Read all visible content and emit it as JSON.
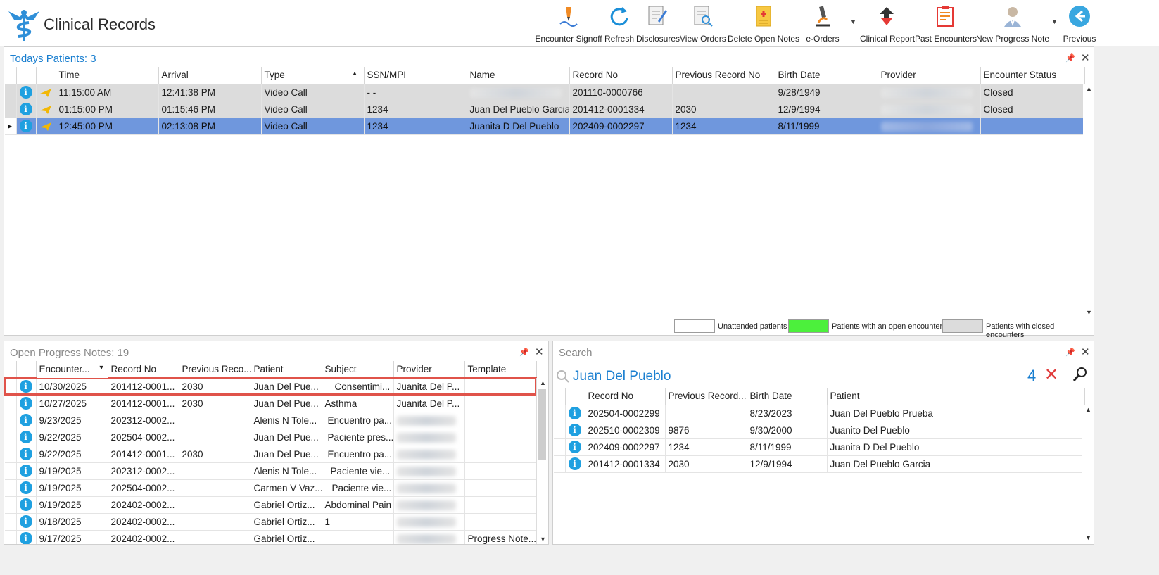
{
  "app": {
    "title": "Clinical Records"
  },
  "toolbar": {
    "encounter_signoff": "Encounter Signoff",
    "refresh": "Refresh",
    "disclosures": "Disclosures",
    "view_orders": "View Orders",
    "delete_open_notes": "Delete Open Notes",
    "e_orders": "e-Orders",
    "clinical_report": "Clinical Report",
    "past_encounters": "Past Encounters",
    "new_progress_note": "New Progress Note",
    "previous": "Previous"
  },
  "todays_patients": {
    "title": "Todays Patients:",
    "count": "3",
    "columns": [
      "Time",
      "Arrival",
      "Type",
      "SSN/MPI",
      "Name",
      "Record No",
      "Previous Record No",
      "Birth Date",
      "Provider",
      "Encounter Status"
    ],
    "rows": [
      {
        "time": "11:15:00 AM",
        "arrival": "12:41:38 PM",
        "type": "Video Call",
        "ssn": "- -",
        "name": "",
        "record_no": "201110-0000766",
        "prev_record": "",
        "birth_date": "9/28/1949",
        "status": "Closed"
      },
      {
        "time": "01:15:00 PM",
        "arrival": "01:15:46 PM",
        "type": "Video Call",
        "ssn": "1234",
        "name": "Juan Del Pueblo Garcia",
        "record_no": "201412-0001334",
        "prev_record": "2030",
        "birth_date": "12/9/1994",
        "status": "Closed"
      },
      {
        "time": "12:45:00 PM",
        "arrival": "02:13:08 PM",
        "type": "Video Call",
        "ssn": "1234",
        "name": "Juanita D Del Pueblo",
        "record_no": "202409-0002297",
        "prev_record": "1234",
        "birth_date": "8/11/1999",
        "status": ""
      }
    ],
    "legend": {
      "unattended": "Unattended patients",
      "open_encounter": "Patients with an open encounter",
      "closed_encounter": "Patients with closed encounters",
      "colors": {
        "unattended": "#ffffff",
        "open": "#4cf03c",
        "closed": "#dcdcdc"
      }
    }
  },
  "open_notes": {
    "title": "Open Progress Notes:",
    "count": "19",
    "columns": [
      "Encounter...",
      "Record No",
      "Previous Reco...",
      "Patient",
      "Subject",
      "Provider",
      "Template"
    ],
    "rows": [
      {
        "date": "10/30/2025",
        "record_no": "201412-0001...",
        "prev": "2030",
        "patient": "Juan Del Pue...",
        "subject": "Consentimi...",
        "provider": "Juanita Del P...",
        "template": ""
      },
      {
        "date": "10/27/2025",
        "record_no": "201412-0001...",
        "prev": "2030",
        "patient": "Juan Del Pue...",
        "subject": "Asthma",
        "provider": "Juanita Del P...",
        "template": ""
      },
      {
        "date": "9/23/2025",
        "record_no": "202312-0002...",
        "prev": "",
        "patient": "Alenis N Tole...",
        "subject": "Encuentro pa...",
        "provider": "",
        "template": ""
      },
      {
        "date": "9/22/2025",
        "record_no": "202504-0002...",
        "prev": "",
        "patient": "Juan Del Pue...",
        "subject": "Paciente pres...",
        "provider": "",
        "template": ""
      },
      {
        "date": "9/22/2025",
        "record_no": "201412-0001...",
        "prev": "2030",
        "patient": "Juan Del Pue...",
        "subject": "Encuentro pa...",
        "provider": "",
        "template": ""
      },
      {
        "date": "9/19/2025",
        "record_no": "202312-0002...",
        "prev": "",
        "patient": "Alenis N Tole...",
        "subject": "Paciente vie...",
        "provider": "",
        "template": ""
      },
      {
        "date": "9/19/2025",
        "record_no": "202504-0002...",
        "prev": "",
        "patient": "Carmen V Vaz...",
        "subject": "Paciente vie...",
        "provider": "",
        "template": ""
      },
      {
        "date": "9/19/2025",
        "record_no": "202402-0002...",
        "prev": "",
        "patient": "Gabriel Ortiz...",
        "subject": "Abdominal Pain",
        "provider": "",
        "template": ""
      },
      {
        "date": "9/18/2025",
        "record_no": "202402-0002...",
        "prev": "",
        "patient": "Gabriel Ortiz...",
        "subject": "1",
        "provider": "",
        "template": ""
      },
      {
        "date": "9/17/2025",
        "record_no": "202402-0002...",
        "prev": "",
        "patient": "Gabriel Ortiz...",
        "subject": "",
        "provider": "",
        "template": "Progress Note..."
      }
    ]
  },
  "search": {
    "title": "Search",
    "query": "Juan Del Pueblo",
    "result_count": "4",
    "columns": [
      "Record No",
      "Previous Record...",
      "Birth Date",
      "Patient"
    ],
    "rows": [
      {
        "record_no": "202504-0002299",
        "prev": "",
        "birth_date": "8/23/2023",
        "patient": "Juan Del Pueblo Prueba"
      },
      {
        "record_no": "202510-0002309",
        "prev": "9876",
        "birth_date": "9/30/2000",
        "patient": "Juanito Del Pueblo"
      },
      {
        "record_no": "202409-0002297",
        "prev": "1234",
        "birth_date": "8/11/1999",
        "patient": "Juanita D Del Pueblo"
      },
      {
        "record_no": "201412-0001334",
        "prev": "2030",
        "birth_date": "12/9/1994",
        "patient": "Juan Del Pueblo Garcia"
      }
    ]
  },
  "colors": {
    "accent": "#1a7fd0",
    "selection": "#6f97dd",
    "highlight_border": "#e0534a",
    "close_red": "#e03b3b"
  }
}
